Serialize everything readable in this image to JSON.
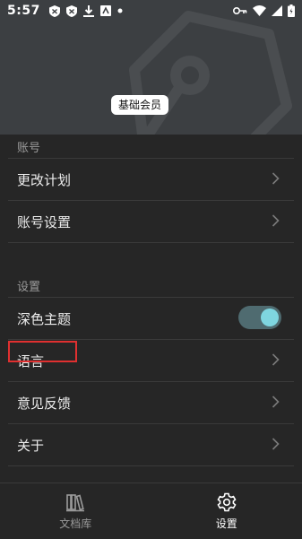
{
  "status_bar": {
    "time": "5:57"
  },
  "header": {
    "membership_badge": "基础会员"
  },
  "sections": {
    "account": {
      "title": "账号",
      "items": [
        {
          "label": "更改计划"
        },
        {
          "label": "账号设置"
        }
      ]
    },
    "settings": {
      "title": "设置",
      "items": [
        {
          "label": "深色主题",
          "toggle_on": true
        },
        {
          "label": "语言"
        },
        {
          "label": "意见反馈"
        },
        {
          "label": "关于"
        }
      ]
    }
  },
  "tabbar": {
    "tabs": [
      {
        "label": "文档库",
        "icon": "library-icon",
        "active": false
      },
      {
        "label": "设置",
        "icon": "gear-icon",
        "active": true
      }
    ]
  },
  "colors": {
    "accent_toggle_knob": "#7fd6e0",
    "highlight_box": "#e03030",
    "header_bg": "#3c3f42",
    "page_bg": "#262626"
  }
}
